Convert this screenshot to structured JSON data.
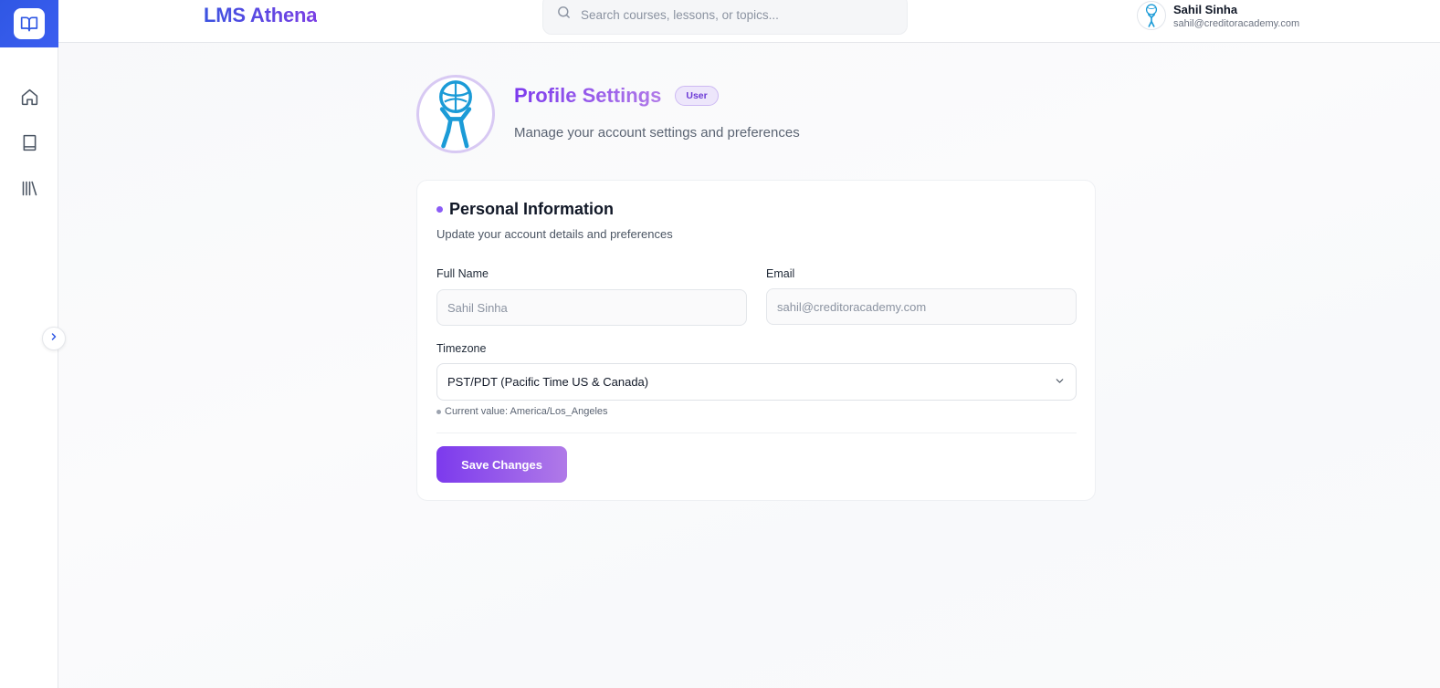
{
  "app": {
    "brand": "LMS Athena"
  },
  "search": {
    "placeholder": "Search courses, lessons, or topics..."
  },
  "user": {
    "name": "Sahil Sinha",
    "email": "sahil@creditoracademy.com"
  },
  "sidebar": {
    "items": [
      {
        "icon": "home-icon"
      },
      {
        "icon": "book-icon"
      },
      {
        "icon": "library-icon"
      }
    ]
  },
  "profile": {
    "title": "Profile Settings",
    "badge": "User",
    "subtitle": "Manage your account settings and preferences"
  },
  "form": {
    "section_title": "Personal Information",
    "section_subtitle": "Update your account details and preferences",
    "full_name_label": "Full Name",
    "full_name_value": "Sahil Sinha",
    "email_label": "Email",
    "email_value": "sahil@creditoracademy.com",
    "timezone_label": "Timezone",
    "timezone_value": "PST/PDT (Pacific Time US & Canada)",
    "timezone_hint": "Current value: America/Los_Angeles",
    "save_label": "Save Changes"
  },
  "colors": {
    "brand_blue": "#2f57e4",
    "accent_purple": "#7c3aed",
    "accent_light_purple": "#b07ae8"
  }
}
